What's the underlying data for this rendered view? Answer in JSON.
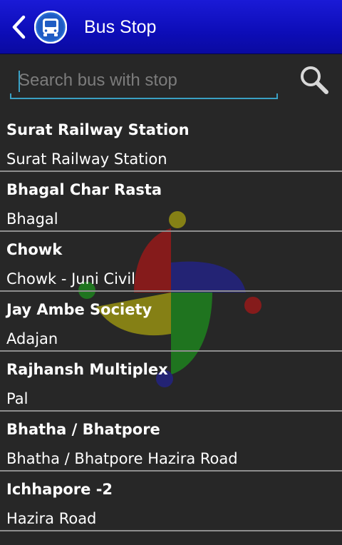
{
  "header": {
    "title": "Bus Stop",
    "back_icon": "chevron-left-icon",
    "logo_icon": "bus-icon"
  },
  "search": {
    "placeholder": "Search bus with stop",
    "value": "",
    "icon": "search-icon",
    "accent_color": "#3aa0c4"
  },
  "colors": {
    "header": "#1212c8",
    "background": "#272727",
    "divider": "#8e8e8e"
  },
  "stops": [
    {
      "name": "Surat Railway Station",
      "area": "Surat Railway Station"
    },
    {
      "name": "Bhagal Char Rasta",
      "area": "Bhagal"
    },
    {
      "name": "Chowk",
      "area": "Chowk - Juni Civil"
    },
    {
      "name": "Jay Ambe Society",
      "area": "Adajan"
    },
    {
      "name": "Rajhansh Multiplex",
      "area": "Pal"
    },
    {
      "name": "Bhatha / Bhatpore",
      "area": "Bhatha / Bhatpore Hazira Road"
    },
    {
      "name": "Ichhapore -2",
      "area": "Hazira Road"
    }
  ]
}
